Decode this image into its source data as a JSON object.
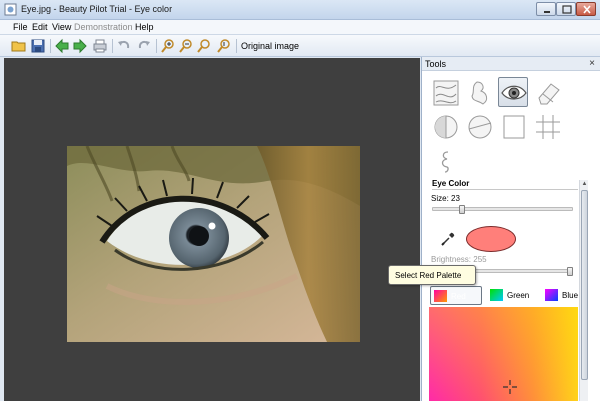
{
  "window": {
    "title": "Eye.jpg - Beauty Pilot Trial - Eye color"
  },
  "menu": [
    {
      "label": "File",
      "disabled": false
    },
    {
      "label": "Edit",
      "disabled": false
    },
    {
      "label": "View",
      "disabled": false
    },
    {
      "label": "Demonstration",
      "disabled": true
    },
    {
      "label": "Help",
      "disabled": false
    }
  ],
  "toolbar": {
    "original_image_label": "Original image",
    "buttons": [
      "open-icon",
      "save-icon",
      "back-arrow-icon",
      "forward-arrow-icon",
      "print-icon",
      "undo-icon",
      "redo-icon",
      "zoom-in-icon",
      "zoom-out-icon",
      "zoom-fit-icon",
      "zoom-actual-icon"
    ]
  },
  "tools_panel": {
    "title": "Tools",
    "close_glyph": "×",
    "tools": [
      "texture-tool",
      "tan-tool",
      "eye-tool",
      "eraser-tool",
      "contrast-tool",
      "circle-tool",
      "frame-tool",
      "grid-tool",
      "curl-tool"
    ],
    "selected_tool": "eye-tool"
  },
  "eye_color": {
    "header": "Eye Color",
    "size_label": "Size: 23",
    "size_value": 23,
    "size_fraction": 0.2,
    "brightness_label": "Brightness: 255",
    "brightness_fraction": 1.0,
    "swatch_color": "#ff7f7a"
  },
  "tooltip": {
    "text": "Select Red Palette"
  },
  "palettes": [
    {
      "label": "Red",
      "selected": true
    },
    {
      "label": "Green",
      "selected": false
    },
    {
      "label": "Blue",
      "selected": false
    }
  ],
  "colors": {
    "canvas_bg": "#3f3f3f",
    "accent": "#4a7ab8"
  }
}
